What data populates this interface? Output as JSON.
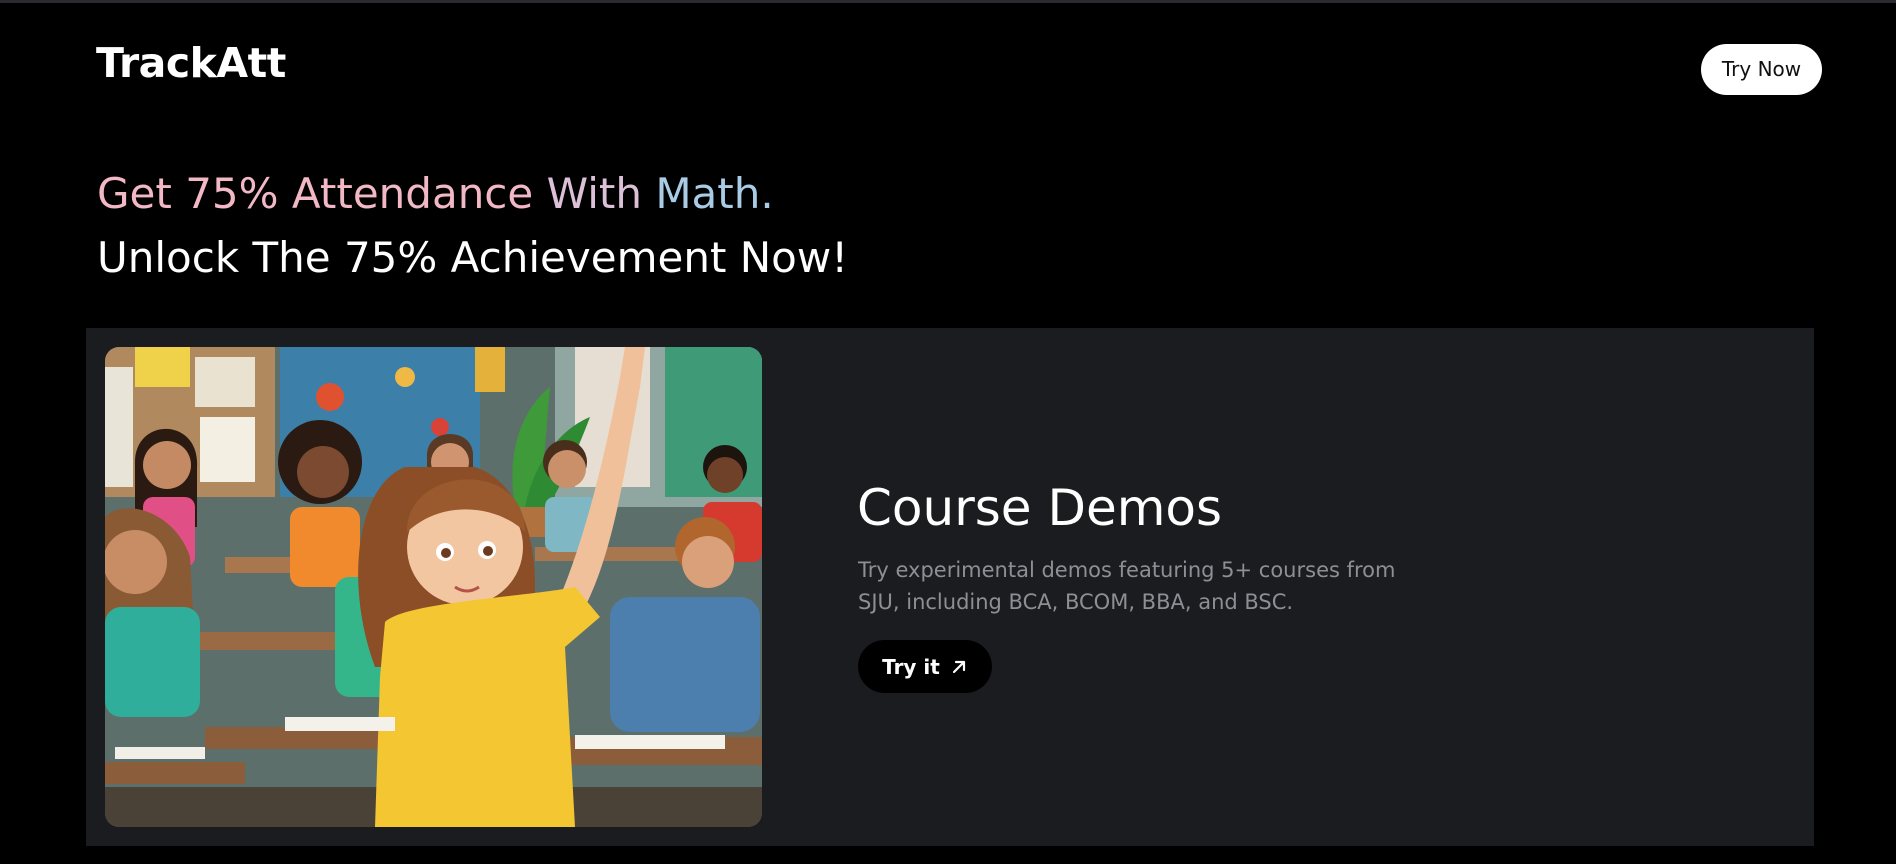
{
  "header": {
    "logo": "TrackAtt",
    "cta_label": "Try Now"
  },
  "hero": {
    "line1_part1": "Get 75% Attendance",
    "line1_part2": " With",
    "line1_part3": " Math.",
    "line2": "Unlock The 75% Achievement Now!"
  },
  "card": {
    "title": "Course Demos",
    "description": "Try experimental demos featuring 5+ courses from SJU, including BCA, BCOM, BBA, and BSC.",
    "button_label": "Try it",
    "button_icon": "arrow-up-right-icon"
  },
  "colors": {
    "background": "#000000",
    "card_background": "#1b1c1f",
    "headline_pink": "#f2b8c6",
    "headline_blue": "#a9cbe6",
    "muted_text": "#8e8f94"
  }
}
